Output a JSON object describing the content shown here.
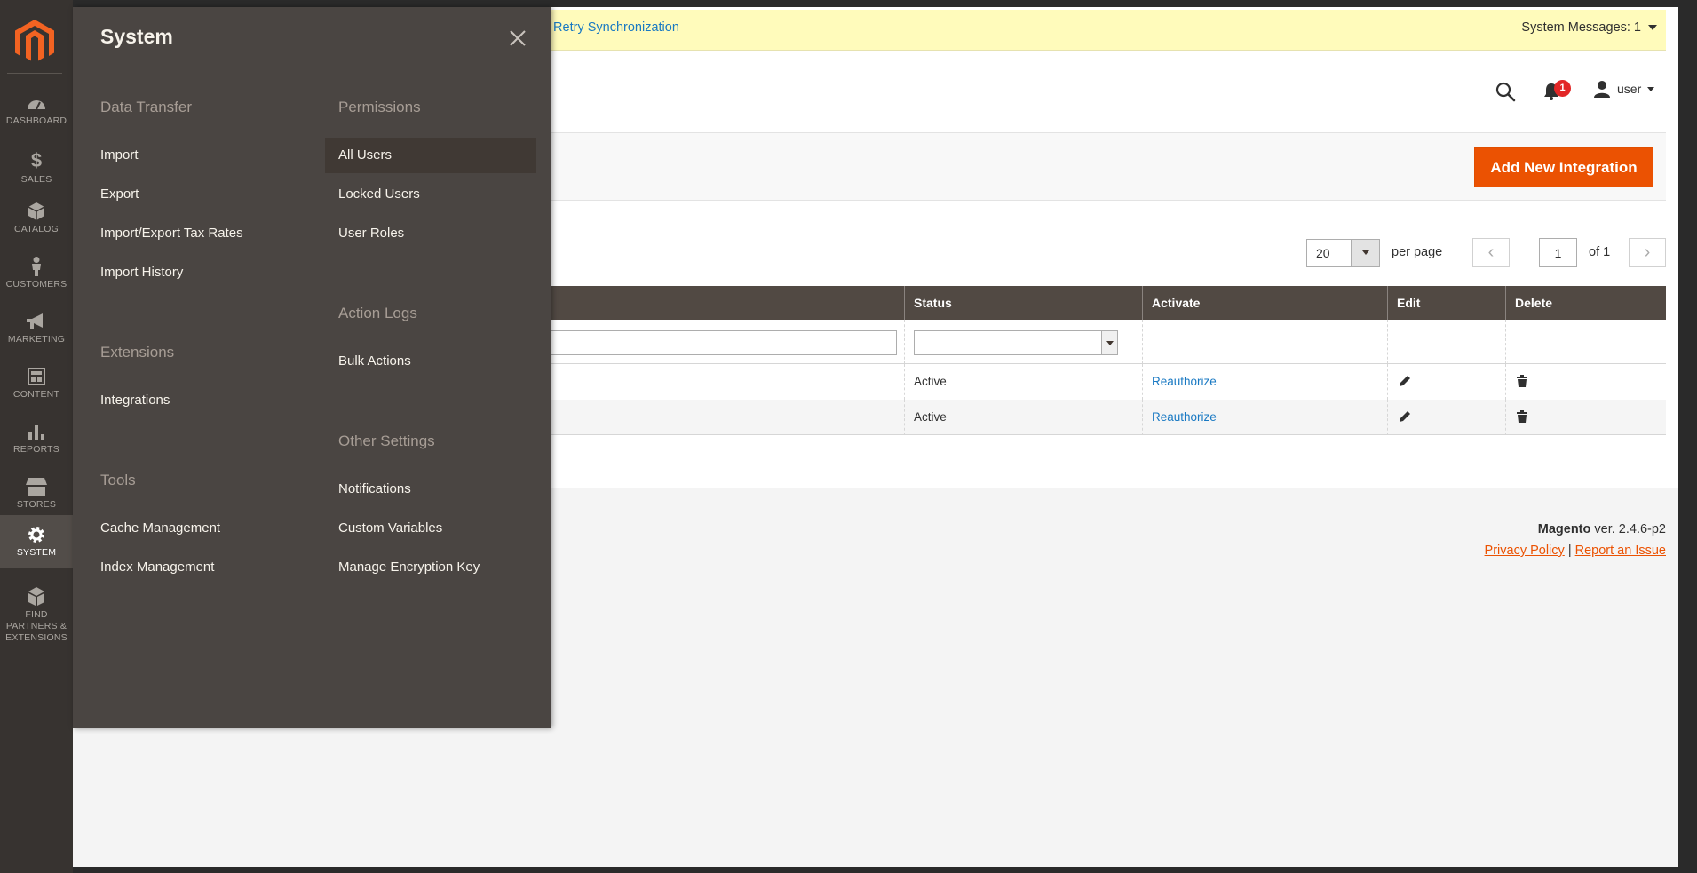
{
  "admin_nav": {
    "items": [
      {
        "label": "Dashboard",
        "icon": "dashboard-icon"
      },
      {
        "label": "Sales",
        "icon": "dollar-icon"
      },
      {
        "label": "Catalog",
        "icon": "cube-icon"
      },
      {
        "label": "Customers",
        "icon": "person-icon"
      },
      {
        "label": "Marketing",
        "icon": "megaphone-icon"
      },
      {
        "label": "Content",
        "icon": "layout-icon"
      },
      {
        "label": "Reports",
        "icon": "bar-chart-icon"
      },
      {
        "label": "Stores",
        "icon": "storefront-icon"
      },
      {
        "label": "System",
        "icon": "gear-icon"
      },
      {
        "label": "Find Partners & Extensions",
        "icon": "boxes-icon"
      }
    ],
    "active": "System"
  },
  "system_messages": {
    "link_text": ". Retry Synchronization",
    "count_text": "System Messages: 1"
  },
  "header": {
    "notification_count": "1",
    "user_name": "user"
  },
  "page_actions": {
    "add_button": "Add New Integration"
  },
  "pager": {
    "per_page_value": "20",
    "per_page_label": "per page",
    "current_page": "1",
    "of_text": "of 1"
  },
  "grid": {
    "columns": [
      "Status",
      "Activate",
      "Edit",
      "Delete"
    ],
    "rows": [
      {
        "status": "Active",
        "activate": "Reauthorize"
      },
      {
        "status": "Active",
        "activate": "Reauthorize"
      }
    ]
  },
  "footer": {
    "brand": "Magento",
    "version": " ver. 2.4.6-p2",
    "privacy": "Privacy Policy",
    "separator": "|",
    "report": "Report an Issue"
  },
  "submenu": {
    "title": "System",
    "groups": {
      "data_transfer": {
        "title": "Data Transfer",
        "items": [
          "Import",
          "Export",
          "Import/Export Tax Rates",
          "Import History"
        ]
      },
      "extensions": {
        "title": "Extensions",
        "items": [
          "Integrations"
        ]
      },
      "tools": {
        "title": "Tools",
        "items": [
          "Cache Management",
          "Index Management"
        ]
      },
      "permissions": {
        "title": "Permissions",
        "items": [
          "All Users",
          "Locked Users",
          "User Roles"
        ]
      },
      "action_logs": {
        "title": "Action Logs",
        "items": [
          "Bulk Actions"
        ]
      },
      "other_settings": {
        "title": "Other Settings",
        "items": [
          "Notifications",
          "Custom Variables",
          "Manage Encryption Key"
        ]
      }
    }
  },
  "colors": {
    "nav_bg": "#373330",
    "submenu_bg": "#4a4542",
    "accent": "#eb5202",
    "link": "#1979c3",
    "message_bg": "#fffbbb"
  }
}
